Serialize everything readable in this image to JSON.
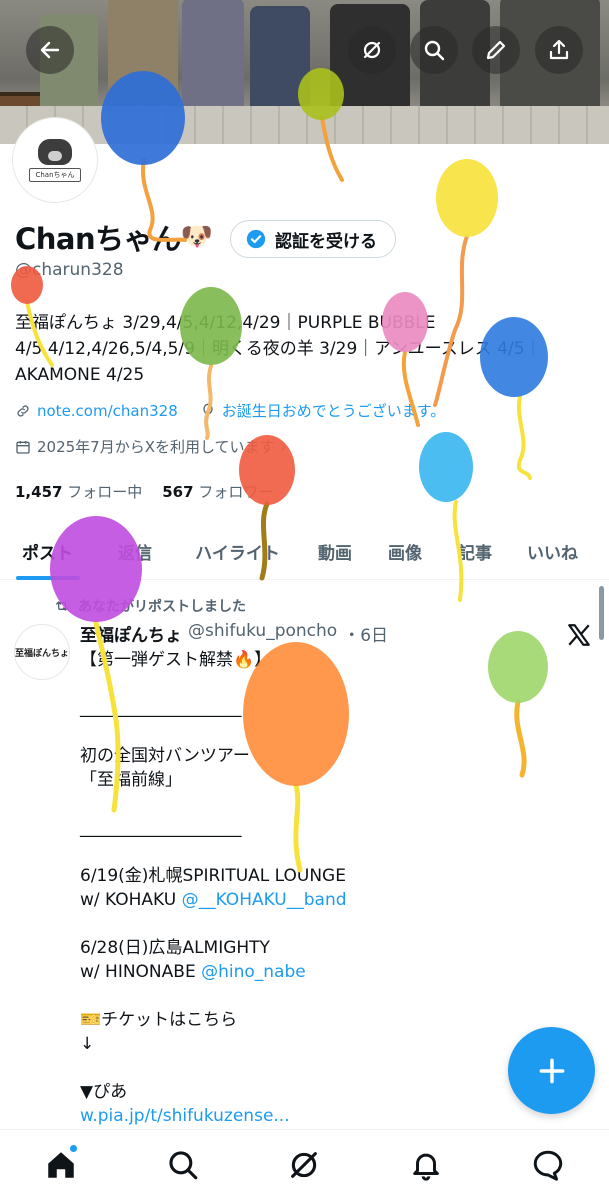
{
  "header": {
    "back_icon": "arrow-left-icon",
    "actions": [
      "grok-icon",
      "search-icon",
      "edit-icon",
      "share-icon"
    ]
  },
  "profile": {
    "display_name": "Chanちゃん",
    "name_emoji": "🐶",
    "avatar_label": "Chanちゃん",
    "verify_button": "認証を受ける",
    "handle": "@charun328",
    "bio": "至福ぽんちょ 3/29,4/5,4/12,4/29｜PURPLE BUBBLE 4/5,4/12,4/26,5/4,5/9｜明くる夜の羊 3/29｜アンユースレス 4/5｜AKAMONE 4/25",
    "link": "note.com/chan328",
    "birthday": "お誕生日おめでとうございます。",
    "joined": "2025年7月からXを利用しています",
    "following_count": "1,457",
    "following_label": "フォロー中",
    "followers_count": "567",
    "followers_label": "フォロワー"
  },
  "tabs": [
    "ポスト",
    "返信",
    "ハイライト",
    "動画",
    "画像",
    "記事",
    "いいね"
  ],
  "active_tab": 0,
  "post": {
    "repost_label": "あなたがリポストしました",
    "author": "至福ぽんちょ",
    "author_handle": "@shifuku_poncho",
    "time": "・6日",
    "avatar_label": "至福ぽんちょ",
    "lines": [
      "【第一弾ゲスト解禁🔥】",
      "",
      "___________________",
      "",
      "初の全国対バンツアー",
      "「至福前線」",
      "",
      "___________________",
      "",
      "6/19(金)札幌SPIRITUAL LOUNGE",
      "w/ KOHAKU ",
      "",
      "6/28(日)広島ALMIGHTY",
      "w/ HINONABE ",
      "",
      "🎫チケットはこちら",
      "↓",
      "",
      "▼ぴあ",
      "w.pia.jp/t/shifukuzense..."
    ],
    "mention_kohaku": "@__KOHAKU__band",
    "mention_hinonabe": "@hino_nabe"
  },
  "fab_icon": "plus-icon",
  "bottom_nav": [
    "home-icon",
    "search-icon",
    "grok-icon",
    "bell-icon",
    "messages-icon"
  ],
  "colors": {
    "accent": "#1d9bf0",
    "text": "#0f1419",
    "secondary": "#536471"
  }
}
